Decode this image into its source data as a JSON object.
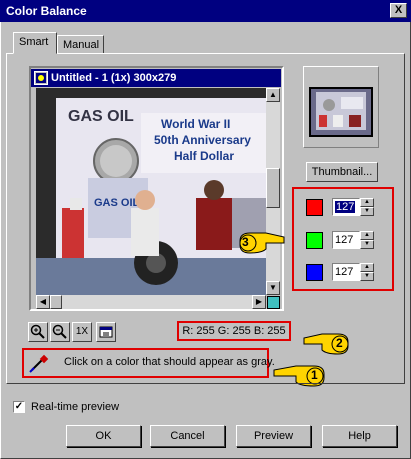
{
  "window": {
    "title": "Color Balance",
    "close_glyph": "X"
  },
  "tabs": [
    {
      "label": "Smart"
    },
    {
      "label": "Manual"
    }
  ],
  "preview": {
    "title": "Untitled - 1 (1x) 300x279",
    "image_text": {
      "gas_oil": "GAS OIL",
      "headline1": "World War II",
      "headline2": "50th Anniversary",
      "headline3": "Half Dollar",
      "coin_text": "GAS OIL"
    }
  },
  "tools": [
    {
      "icon": "zoom-in-icon"
    },
    {
      "icon": "zoom-out-icon"
    },
    {
      "label": "1X"
    },
    {
      "icon": "fit-window-icon"
    }
  ],
  "thumbnail_button": "Thumbnail...",
  "channels": [
    {
      "name": "red",
      "color": "#ff0000",
      "value": "127"
    },
    {
      "name": "green",
      "color": "#00ff00",
      "value": "127"
    },
    {
      "name": "blue",
      "color": "#0000ff",
      "value": "127"
    }
  ],
  "rgb_readout": "R: 255  G: 255  B: 255",
  "instruction": "Click on a color that should appear as gray.",
  "pointers": {
    "one": "1",
    "two": "2",
    "three": "3"
  },
  "realtime_preview": {
    "label": "Real-time preview",
    "checked": true
  },
  "buttons": {
    "ok": "OK",
    "cancel": "Cancel",
    "preview": "Preview",
    "help": "Help"
  }
}
